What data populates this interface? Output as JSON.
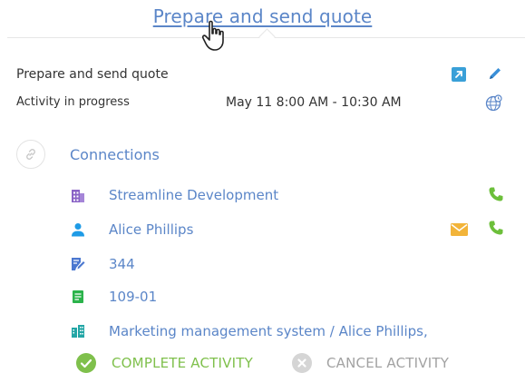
{
  "header": {
    "title_link": "Prepare and send quote"
  },
  "activity": {
    "subject": "Prepare and send quote",
    "status": "Activity in progress",
    "dates": "May 11 8:00 AM - 10:30 AM"
  },
  "connections": {
    "label": "Connections",
    "items": [
      {
        "icon": "account-icon",
        "label": "Streamline Development"
      },
      {
        "icon": "contact-icon",
        "label": "Alice Phillips"
      },
      {
        "icon": "opportunity-icon",
        "label": "344"
      },
      {
        "icon": "document-icon",
        "label": "109-01"
      },
      {
        "icon": "project-icon",
        "label": "Marketing management system / Alice Phillips,"
      }
    ]
  },
  "actions": {
    "complete_label": "COMPLETE ACTIVITY",
    "cancel_label": "CANCEL ACTIVITY"
  },
  "colors": {
    "link": "#5b86c8",
    "complete": "#7fc04c",
    "phone": "#6cbf3a",
    "mail": "#f2b43a",
    "account": "#8a63c6",
    "contact": "#1e9be6",
    "opportunity": "#4b78d0",
    "document": "#2bb34b",
    "project": "#23a6a6"
  }
}
